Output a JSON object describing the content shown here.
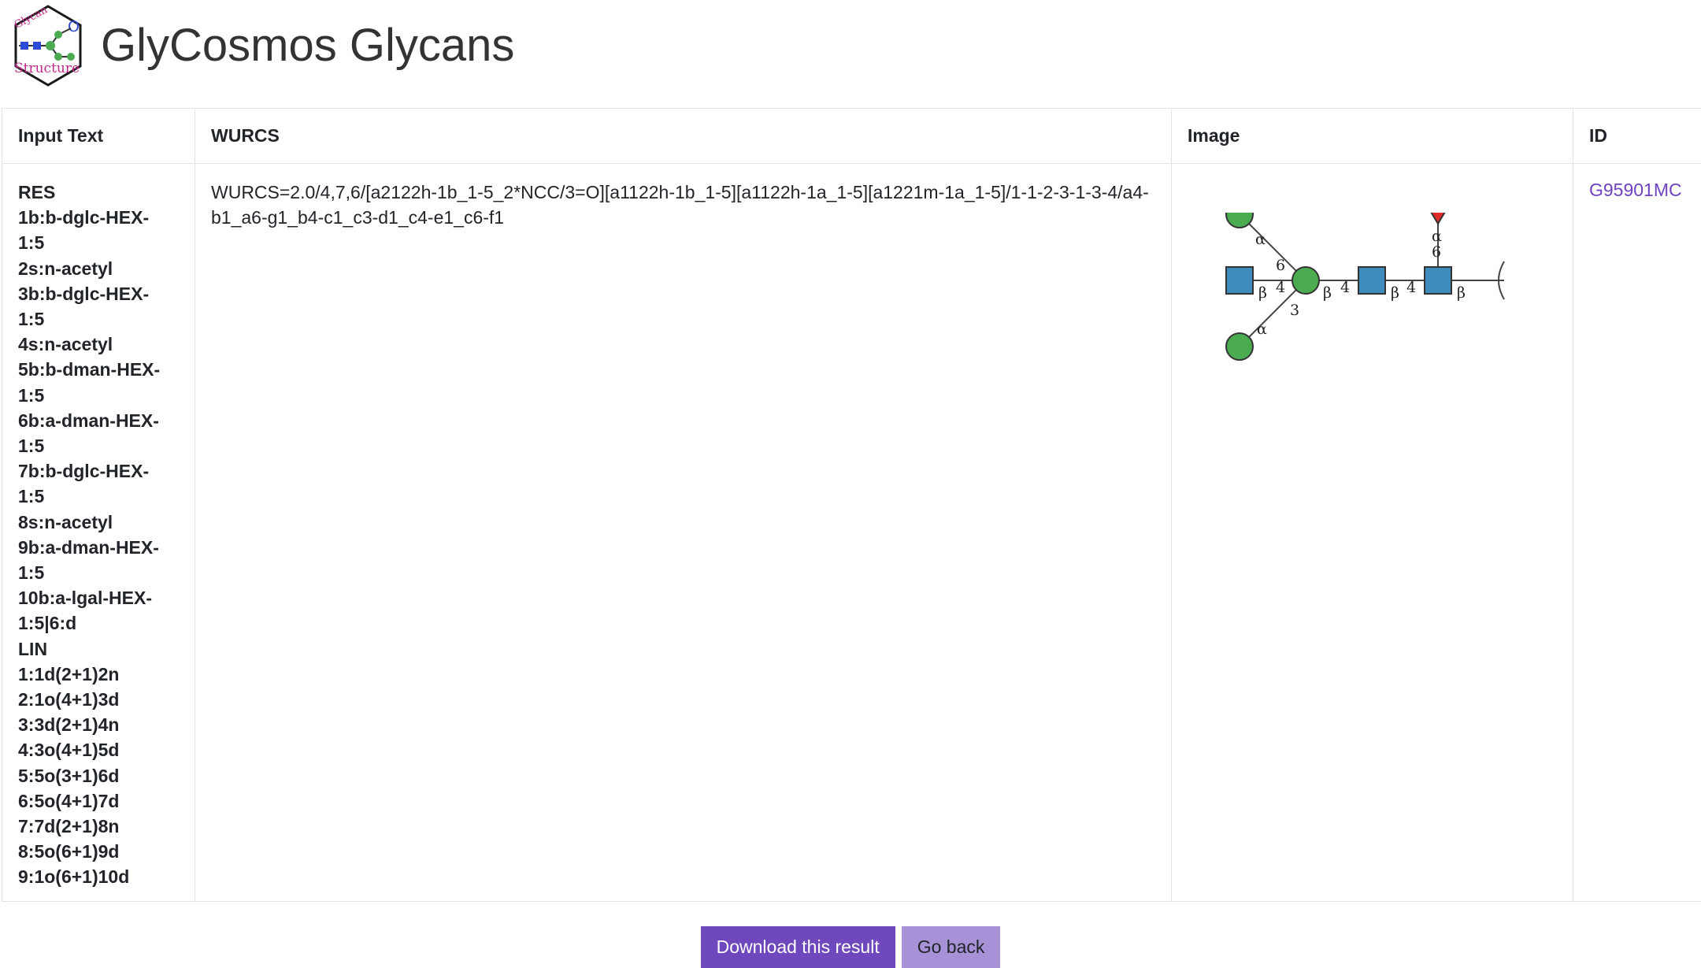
{
  "header": {
    "title": "GlyCosmos Glycans",
    "logo_icon": "glycan-structure-logo-icon",
    "logo_text_top": "Glycan",
    "logo_text_bottom": "Structure",
    "logo_letter": "O"
  },
  "table": {
    "columns": [
      "Input Text",
      "WURCS",
      "Image",
      "ID"
    ],
    "row": {
      "input_text_lines": [
        "RES",
        "1b:b-dglc-HEX-",
        "1:5",
        "2s:n-acetyl",
        "3b:b-dglc-HEX-",
        "1:5",
        "4s:n-acetyl",
        "5b:b-dman-HEX-",
        "1:5",
        "6b:a-dman-HEX-",
        "1:5",
        "7b:b-dglc-HEX-",
        "1:5",
        "8s:n-acetyl",
        "9b:a-dman-HEX-",
        "1:5",
        "10b:a-lgal-HEX-",
        "1:5|6:d",
        "LIN",
        "1:1d(2+1)2n",
        "2:1o(4+1)3d",
        "3:3d(2+1)4n",
        "4:3o(4+1)5d",
        "5:5o(3+1)6d",
        "6:5o(4+1)7d",
        "7:7d(2+1)8n",
        "8:5o(6+1)9d",
        "9:1o(6+1)10d"
      ],
      "wurcs": "WURCS=2.0/4,7,6/[a2122h-1b_1-5_2*NCC/3=O][a1122h-1b_1-5][a1122h-1a_1-5][a1221m-1a_1-5]/1-1-2-3-1-3-4/a4-b1_a6-g1_b4-c1_c3-d1_c4-e1_c6-f1",
      "image": {
        "icon": "glycan-snfg-structure-image",
        "labels": {
          "alpha": "α",
          "beta": "β",
          "link_6": "6",
          "link_4": "4",
          "link_3": "3"
        }
      },
      "id": "G95901MC"
    }
  },
  "actions": {
    "download_label": "Download this result",
    "back_label": "Go back"
  },
  "colors": {
    "accent": "#6f48bd",
    "accent_light": "#a792d8",
    "link": "#6f42c1",
    "glc_green": "#4bab51",
    "glcnac_blue": "#3d8cbd",
    "fuc_red": "#e02b2b"
  }
}
